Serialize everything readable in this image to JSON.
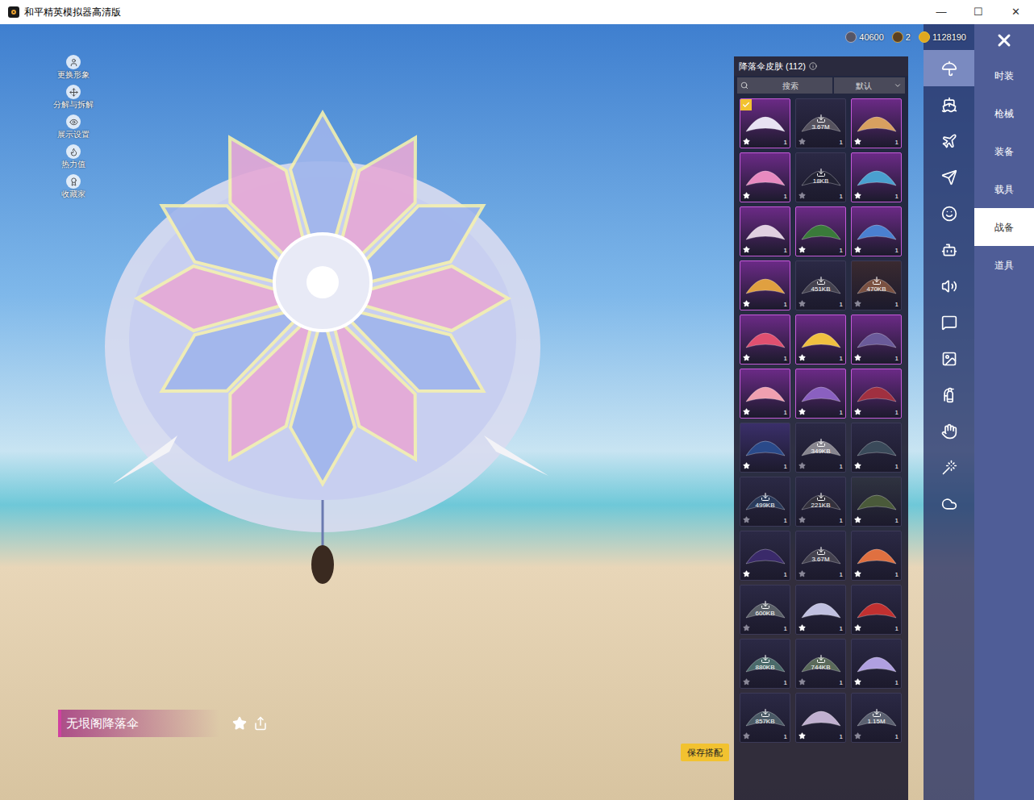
{
  "window": {
    "title": "和平精英模拟器高清版",
    "controls": [
      "—",
      "☐",
      "✕"
    ]
  },
  "left_tools": [
    {
      "label": "更换形象"
    },
    {
      "label": "分解与拆解"
    },
    {
      "label": "展示设置"
    },
    {
      "label": "热力值"
    },
    {
      "label": "收藏家"
    }
  ],
  "currency": [
    {
      "value": "40600"
    },
    {
      "value": "2"
    },
    {
      "value": "1128190"
    }
  ],
  "panel": {
    "title": "降落伞皮肤 (112)",
    "search": {
      "placeholder": "搜索"
    },
    "sort": "默认"
  },
  "items": [
    {
      "selected": true,
      "download": "",
      "starred": true,
      "count": "1",
      "color": "#6b2a86",
      "canopy": "#e8e2f2"
    },
    {
      "selected": false,
      "download": "3.67M",
      "starred": false,
      "count": "1",
      "color": "#2b2945",
      "canopy": "#55525e"
    },
    {
      "selected": false,
      "download": "",
      "starred": true,
      "count": "1",
      "color": "#6b2a86",
      "canopy": "#d8a060"
    },
    {
      "selected": false,
      "download": "",
      "starred": true,
      "count": "1",
      "color": "#6b2a86",
      "canopy": "#e88ac0"
    },
    {
      "selected": false,
      "download": "18KB",
      "starred": false,
      "count": "1",
      "color": "#2b2945",
      "canopy": "#222233"
    },
    {
      "selected": false,
      "download": "",
      "starred": true,
      "count": "1",
      "color": "#6b2a86",
      "canopy": "#4aa0d0"
    },
    {
      "selected": false,
      "download": "",
      "starred": true,
      "count": "1",
      "color": "#6b2a86",
      "canopy": "#e0d0e0"
    },
    {
      "selected": false,
      "download": "",
      "starred": true,
      "count": "1",
      "color": "#6b2a86",
      "canopy": "#3a7a3a"
    },
    {
      "selected": false,
      "download": "",
      "starred": true,
      "count": "1",
      "color": "#6b2a86",
      "canopy": "#4a80d0"
    },
    {
      "selected": false,
      "download": "",
      "starred": true,
      "count": "1",
      "color": "#6b2a86",
      "canopy": "#e0a040"
    },
    {
      "selected": false,
      "download": "451KB",
      "starred": false,
      "count": "1",
      "color": "#2b2945",
      "canopy": "#44424f"
    },
    {
      "selected": false,
      "download": "470KB",
      "starred": false,
      "count": "1",
      "color": "#3a2a30",
      "canopy": "#7a5040"
    },
    {
      "selected": false,
      "download": "",
      "starred": true,
      "count": "1",
      "color": "#6b2a86",
      "canopy": "#e05070"
    },
    {
      "selected": false,
      "download": "",
      "starred": true,
      "count": "1",
      "color": "#6b2a86",
      "canopy": "#f0c040"
    },
    {
      "selected": false,
      "download": "",
      "starred": true,
      "count": "1",
      "color": "#6b2a86",
      "canopy": "#6a5a9a"
    },
    {
      "selected": false,
      "download": "",
      "starred": true,
      "count": "1",
      "color": "#6b2a86",
      "canopy": "#f0a0b0"
    },
    {
      "selected": false,
      "download": "",
      "starred": true,
      "count": "1",
      "color": "#6b2a86",
      "canopy": "#8a60c0"
    },
    {
      "selected": false,
      "download": "",
      "starred": true,
      "count": "1",
      "color": "#6b2a86",
      "canopy": "#a03040"
    },
    {
      "selected": false,
      "download": "",
      "starred": true,
      "count": "1",
      "color": "#3a2f6a",
      "canopy": "#2a4a8a"
    },
    {
      "selected": false,
      "download": "349KB",
      "starred": false,
      "count": "1",
      "color": "#2b2945",
      "canopy": "#88868f"
    },
    {
      "selected": false,
      "download": "",
      "starred": true,
      "count": "1",
      "color": "#2b2945",
      "canopy": "#3a4a5a"
    },
    {
      "selected": false,
      "download": "499KB",
      "starred": false,
      "count": "1",
      "color": "#2b2945",
      "canopy": "#2a3a5a"
    },
    {
      "selected": false,
      "download": "221KB",
      "starred": false,
      "count": "1",
      "color": "#2b2945",
      "canopy": "#33313d"
    },
    {
      "selected": false,
      "download": "",
      "starred": true,
      "count": "1",
      "color": "#2f3340",
      "canopy": "#4a5a3a"
    },
    {
      "selected": false,
      "download": "",
      "starred": true,
      "count": "1",
      "color": "#2b2945",
      "canopy": "#3a2a6a"
    },
    {
      "selected": false,
      "download": "3.67M",
      "starred": false,
      "count": "1",
      "color": "#2b2945",
      "canopy": "#44424f"
    },
    {
      "selected": false,
      "download": "",
      "starred": true,
      "count": "1",
      "color": "#2b2945",
      "canopy": "#e07040"
    },
    {
      "selected": false,
      "download": "600KB",
      "starred": false,
      "count": "1",
      "color": "#2b2945",
      "canopy": "#5a6068"
    },
    {
      "selected": false,
      "download": "",
      "starred": true,
      "count": "1",
      "color": "#2b2945",
      "canopy": "#c0c0e0"
    },
    {
      "selected": false,
      "download": "",
      "starred": true,
      "count": "1",
      "color": "#2b2945",
      "canopy": "#c03030"
    },
    {
      "selected": false,
      "download": "880KB",
      "starred": false,
      "count": "1",
      "color": "#2b2945",
      "canopy": "#4a6a6a"
    },
    {
      "selected": false,
      "download": "744KB",
      "starred": false,
      "count": "1",
      "color": "#2b2945",
      "canopy": "#5a6a5a"
    },
    {
      "selected": false,
      "download": "",
      "starred": true,
      "count": "1",
      "color": "#2b2945",
      "canopy": "#b0a0e0"
    },
    {
      "selected": false,
      "download": "857KB",
      "starred": false,
      "count": "1",
      "color": "#2b2945",
      "canopy": "#4a5a66"
    },
    {
      "selected": false,
      "download": "",
      "starred": true,
      "count": "1",
      "color": "#2b2945",
      "canopy": "#c0b0d0"
    },
    {
      "selected": false,
      "download": "1.15M",
      "starred": false,
      "count": "1",
      "color": "#2b2945",
      "canopy": "#5a6070"
    }
  ],
  "nav_icons": [
    {
      "selected": true
    },
    {
      "selected": false
    },
    {
      "selected": false
    },
    {
      "selected": false
    },
    {
      "selected": false
    },
    {
      "selected": false
    },
    {
      "selected": false
    },
    {
      "selected": false
    },
    {
      "selected": false
    },
    {
      "selected": false
    },
    {
      "selected": false
    },
    {
      "selected": false
    },
    {
      "selected": false
    }
  ],
  "categories": [
    {
      "label": "时装",
      "selected": false
    },
    {
      "label": "枪械",
      "selected": false
    },
    {
      "label": "装备",
      "selected": false
    },
    {
      "label": "载具",
      "selected": false
    },
    {
      "label": "战备",
      "selected": true
    },
    {
      "label": "道具",
      "selected": false
    }
  ],
  "item_name": "无垠阁降落伞",
  "save_button": "保存搭配"
}
